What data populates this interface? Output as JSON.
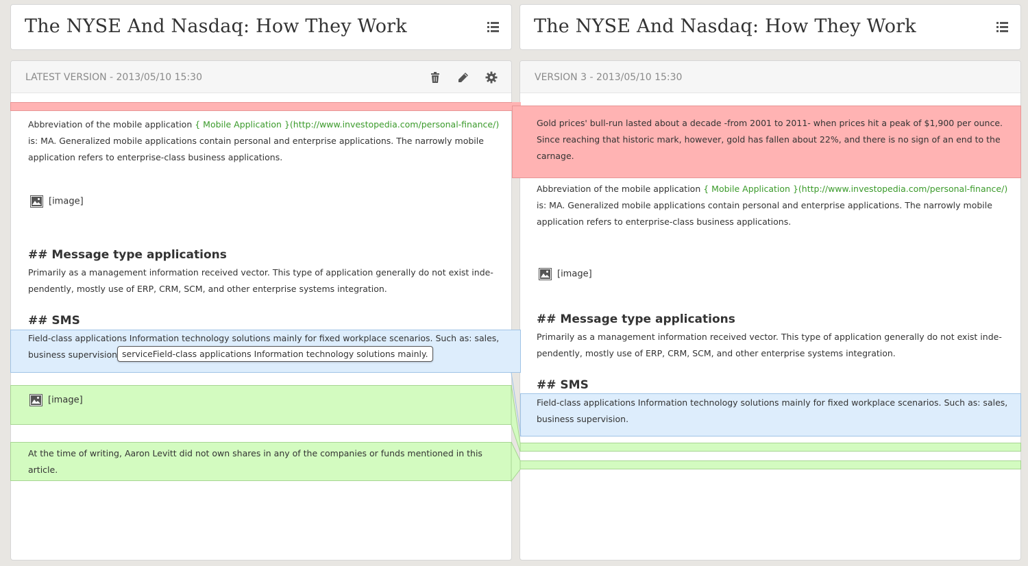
{
  "left": {
    "title": "The NYSE And Nasdaq: How They Work",
    "version_label": "LATEST VERSION - 2013/05/10 15:30",
    "intro_line1_a": "Abbreviation of the mobile application ",
    "intro_link": "{ Mobile Application }(http://www.investopedia.com/personal-finance/)",
    "intro_line2": "is: MA. Generalized mobile applications contain personal and enterprise applications. The narrowly mobile",
    "intro_line3": "application refers to enterprise-class business applications.",
    "image1": "[image]",
    "heading_message": "## Message type applications",
    "msg_line1": "Primarily as a management information received vector. This type of application generally do not exist inde-",
    "msg_line2": "pendently, mostly use of ERP, CRM, SCM, and other enterprise systems integration.",
    "heading_sms": "## SMS",
    "sms_line1": "Field-class applications Information technology solutions mainly for fixed workplace scenarios. Such as: sales,",
    "sms_line2": "business supervision,",
    "tooltip": "serviceField-class applications Information technology solutions mainly.",
    "image2": "[image]",
    "footer_line1": "At the time of writing, Aaron Levitt did not own shares in any of the companies or funds mentioned in this",
    "footer_line2": "article."
  },
  "right": {
    "title": "The NYSE And Nasdaq: How They Work",
    "version_label": "VERSION 3 - 2013/05/10 15:30",
    "gold_line1": "Gold prices' bull-run lasted about a decade -from 2001 to 2011- when prices hit a peak of $1,900 per ounce.",
    "gold_line2": "Since reaching that historic mark, however, gold has fallen about 22%, and there is no sign of an end to the",
    "gold_line3": "carnage.",
    "intro_line1_a": "Abbreviation of the mobile application ",
    "intro_link": "{ Mobile Application }(http://www.investopedia.com/personal-finance/)",
    "intro_line2": "is: MA. Generalized mobile applications contain personal and enterprise applications. The narrowly mobile",
    "intro_line3": "application refers to enterprise-class business applications.",
    "image1": "[image]",
    "heading_message": "## Message type applications",
    "msg_line1": "Primarily as a management information received vector. This type of application generally do not exist inde-",
    "msg_line2": "pendently, mostly use of ERP, CRM, SCM, and other enterprise systems integration.",
    "heading_sms": "## SMS",
    "sms_line1": "Field-class applications Information technology solutions mainly for fixed workplace scenarios. Such as: sales,",
    "sms_line2": "business supervision."
  },
  "colors": {
    "deleted": "#ffb3b3",
    "changed": "#ddedfc",
    "added": "#d3fbc0",
    "link": "#3a9a2a"
  },
  "icons": {
    "list": "list-icon",
    "delete": "trash-icon",
    "edit": "pencil-icon",
    "settings": "gear-icon",
    "image": "image-icon"
  }
}
